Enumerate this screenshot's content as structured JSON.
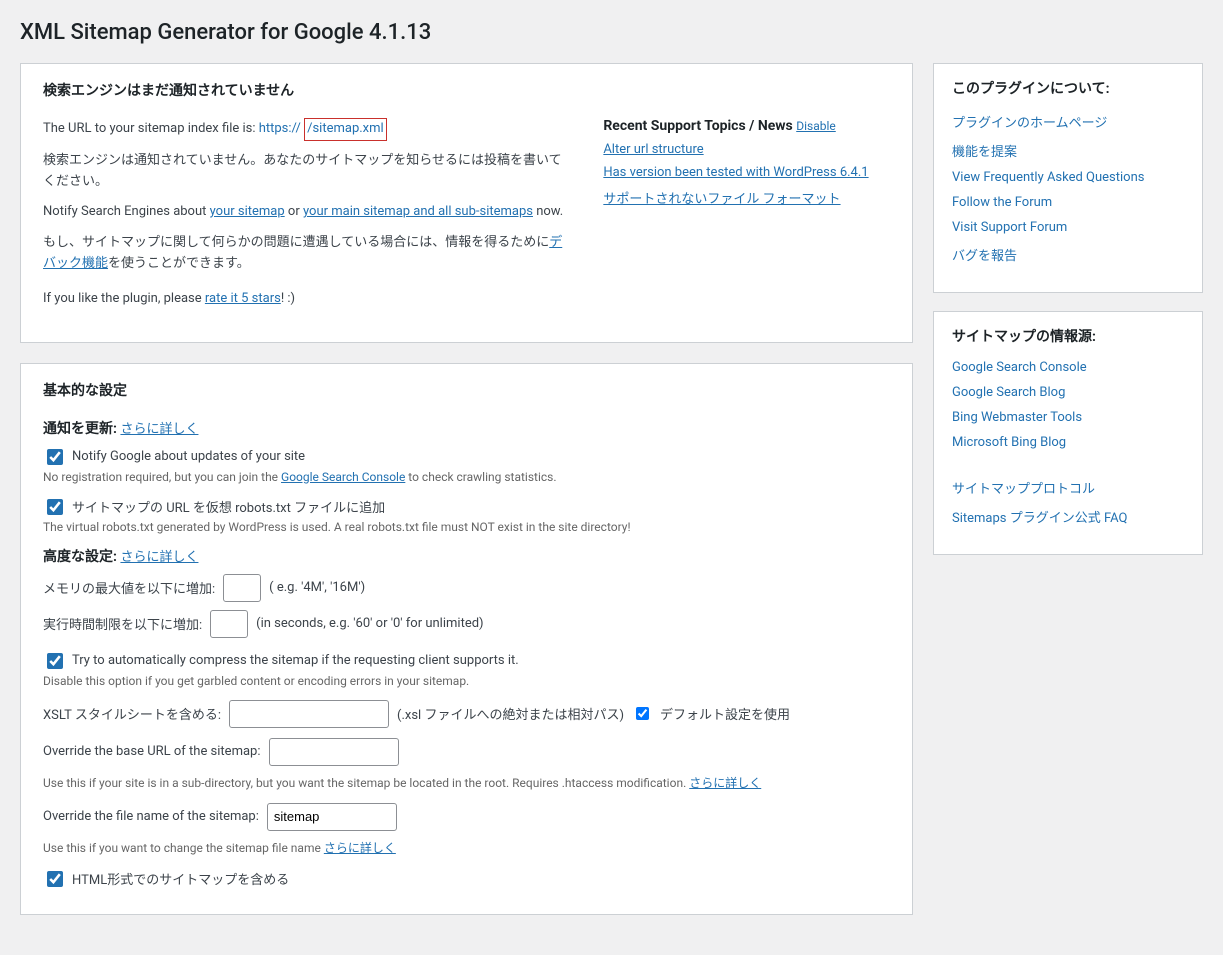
{
  "page": {
    "title": "XML Sitemap Generator for Google 4.1.13"
  },
  "status_box": {
    "heading": "検索エンジンはまだ通知されていません",
    "url_prefix": "The URL to your sitemap index file is: ",
    "url_proto": "https://",
    "url_mid": " ",
    "url_path": "/sitemap.xml",
    "notified_text": "検索エンジンは通知されていません。あなたのサイトマップを知らせるには投稿を書いてください。",
    "notify_prefix": "Notify Search Engines about ",
    "notify_link1": "your sitemap",
    "notify_or": " or ",
    "notify_link2": "your main sitemap and all sub-sitemaps",
    "notify_suffix": " now.",
    "debug_prefix": "もし、サイトマップに関して何らかの問題に遭遇している場合には、情報を得るために",
    "debug_link": "デバック機能",
    "debug_suffix": "を使うことができます。",
    "rate_prefix": "If you like the plugin, please ",
    "rate_link": "rate it 5 stars",
    "rate_suffix": "! :)"
  },
  "support": {
    "heading": "Recent Support Topics / News ",
    "disable": "Disable",
    "items": [
      "Alter url structure",
      "Has version been tested with WordPress 6.4.1",
      "サポートされないファイル フォーマット"
    ]
  },
  "basic": {
    "heading": "基本的な設定",
    "update_label": "通知を更新:",
    "learn_more": "さらに詳しく",
    "cb_google": "Notify Google about updates of your site",
    "google_hint_prefix": "No registration required, but you can join the ",
    "google_hint_link": "Google Search Console",
    "google_hint_suffix": " to check crawling statistics.",
    "cb_robots": "サイトマップの URL を仮想 robots.txt ファイルに追加",
    "robots_hint": "The virtual robots.txt generated by WordPress is used. A real robots.txt file must NOT exist in the site directory!",
    "advanced_label": "高度な設定:",
    "mem_label": "メモリの最大値を以下に増加:",
    "mem_hint": "( e.g. '4M', '16M')",
    "time_label": "実行時間制限を以下に増加:",
    "time_hint": "(in seconds, e.g. '60' or '0' for unlimited)",
    "cb_compress": "Try to automatically compress the sitemap if the requesting client supports it.",
    "compress_hint": "Disable this option if you get garbled content or encoding errors in your sitemap.",
    "xslt_label": "XSLT スタイルシートを含める:",
    "xslt_hint": "(.xsl ファイルへの絶対または相対パス)",
    "cb_default": "デフォルト設定を使用",
    "base_url_label": "Override the base URL of the sitemap:",
    "base_url_hint": "Use this if your site is in a sub-directory, but you want the sitemap be located in the root. Requires .htaccess modification. ",
    "filename_label": "Override the file name of the sitemap:",
    "filename_value": "sitemap",
    "filename_hint": "Use this if you want to change the sitemap file name ",
    "cb_html": "HTML形式でのサイトマップを含める"
  },
  "sidebar": {
    "about": {
      "heading": "このプラグインについて:",
      "links": [
        "プラグインのホームページ",
        "機能を提案",
        "View Frequently Asked Questions",
        "Follow the Forum",
        "Visit Support Forum",
        "バグを報告"
      ]
    },
    "resources": {
      "heading": "サイトマップの情報源:",
      "links1": [
        "Google Search Console",
        "Google Search Blog",
        "Bing Webmaster Tools",
        "Microsoft Bing Blog"
      ],
      "links2": [
        "サイトマッププロトコル",
        "Sitemaps プラグイン公式 FAQ"
      ]
    }
  }
}
